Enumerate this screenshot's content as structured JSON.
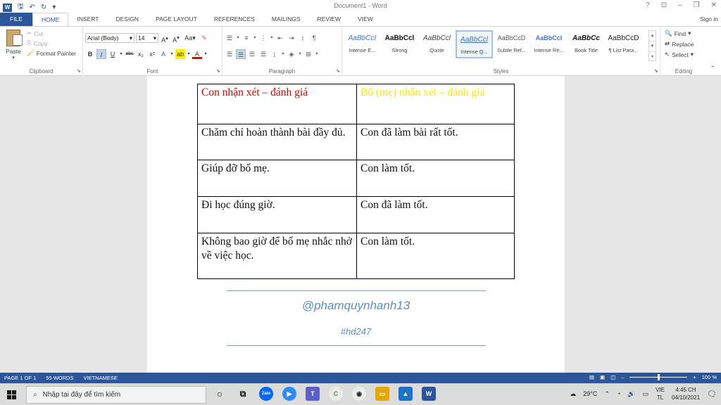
{
  "window": {
    "title": "Document1 - Word",
    "controls": [
      "?",
      "⊡",
      "–",
      "❐",
      "✕"
    ]
  },
  "tabs": [
    {
      "label": "FILE"
    },
    {
      "label": "HOME"
    },
    {
      "label": "INSERT"
    },
    {
      "label": "DESIGN"
    },
    {
      "label": "PAGE LAYOUT"
    },
    {
      "label": "REFERENCES"
    },
    {
      "label": "MAILINGS"
    },
    {
      "label": "REVIEW"
    },
    {
      "label": "VIEW"
    }
  ],
  "signin": "Sign in",
  "clipboard": {
    "paste": "Paste",
    "cut": "Cut",
    "copy": "Copy",
    "format_painter": "Format Painter",
    "label": "Clipboard"
  },
  "font": {
    "family": "Arial (Body)",
    "size": "14",
    "aa": "Aa",
    "label": "Font"
  },
  "paragraph": {
    "label": "Paragraph"
  },
  "styles": {
    "label": "Styles",
    "items": [
      {
        "sample": "AaBbCcI",
        "name": "Intense E..."
      },
      {
        "sample": "AaBbCcl",
        "name": "Strong"
      },
      {
        "sample": "AaBbCcl",
        "name": "Quote"
      },
      {
        "sample": "AaBbCcl",
        "name": "Intense Q..."
      },
      {
        "sample": "AaBbCcD",
        "name": "Subtle Ref..."
      },
      {
        "sample": "AaBbCcI",
        "name": "Intense Re..."
      },
      {
        "sample": "AaBbCc",
        "name": "Book Title"
      },
      {
        "sample": "AaBbCcD",
        "name": "¶ List Para..."
      }
    ]
  },
  "editing": {
    "find": "Find",
    "replace": "Replace",
    "select": "Select",
    "label": "Editing"
  },
  "table": {
    "header": {
      "left": "Con nhận xét – đánh giá",
      "right": "Bố (mẹ) nhận xét – đánh giá"
    },
    "rows": [
      {
        "left": "Chăm chỉ hoàn thành bài đầy đủ.",
        "right": "Con đã làm bài rất tốt."
      },
      {
        "left": "Giúp đỡ bố mẹ.",
        "right": "Con làm tốt."
      },
      {
        "left": "Đi học đúng giờ.",
        "right": "Con đã làm tốt."
      },
      {
        "left": "Không bao giờ để bố mẹ nhắc nhở về việc học.",
        "right": "Con làm tốt."
      }
    ]
  },
  "watermark": {
    "handle": "@phamquynhanh13",
    "tag": "#hd247"
  },
  "status": {
    "page": "PAGE 1 OF 1",
    "words": "55 WORDS",
    "language": "VIETNAMESE",
    "zoom": "100 %"
  },
  "taskbar": {
    "search_placeholder": "Nhập tại đây để tìm kiếm",
    "temperature": "29°C",
    "lang_top": "VIE",
    "lang_bottom": "TL",
    "time": "4:45 CH",
    "date": "04/10/2021"
  }
}
